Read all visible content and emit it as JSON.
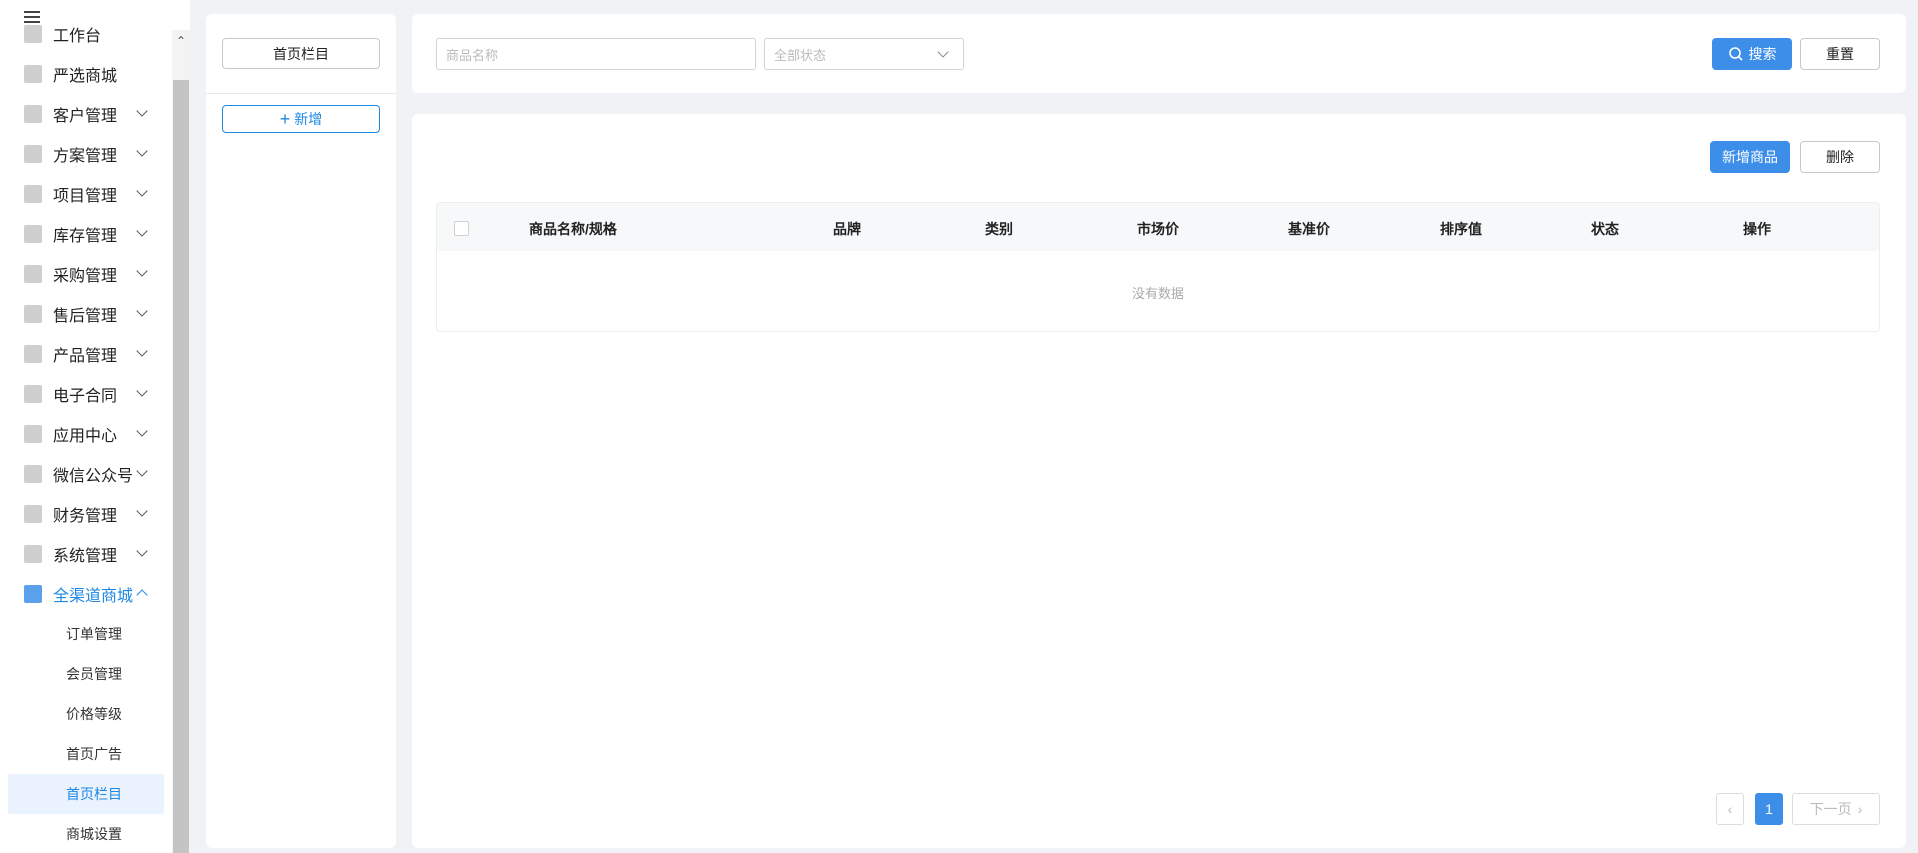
{
  "sidebar": {
    "items": [
      {
        "label": "工作台",
        "icon": "dashboard-icon"
      },
      {
        "label": "严选商城",
        "icon": "mall-icon"
      },
      {
        "label": "客户管理",
        "icon": "customer-icon"
      },
      {
        "label": "方案管理",
        "icon": "plan-icon"
      },
      {
        "label": "项目管理",
        "icon": "folder-icon"
      },
      {
        "label": "库存管理",
        "icon": "inventory-icon"
      },
      {
        "label": "采购管理",
        "icon": "cart-icon"
      },
      {
        "label": "售后管理",
        "icon": "headset-icon"
      },
      {
        "label": "产品管理",
        "icon": "box-icon"
      },
      {
        "label": "电子合同",
        "icon": "contract-icon"
      },
      {
        "label": "应用中心",
        "icon": "apps-icon"
      },
      {
        "label": "微信公众号",
        "icon": "wechat-icon"
      },
      {
        "label": "财务管理",
        "icon": "finance-icon"
      },
      {
        "label": "系统管理",
        "icon": "settings-icon"
      },
      {
        "label": "全渠道商城",
        "icon": "shop-icon"
      }
    ],
    "subitems": [
      "订单管理",
      "会员管理",
      "价格等级",
      "首页广告",
      "首页栏目",
      "商城设置"
    ],
    "selected_sub": "首页栏目",
    "accent": "#1e88e5"
  },
  "column_panel": {
    "column_button": "首页栏目",
    "add_button": "新增"
  },
  "search": {
    "name_placeholder": "商品名称",
    "status_placeholder": "全部状态",
    "search_button": "搜索",
    "reset_button": "重置"
  },
  "toolbar": {
    "add_product": "新增商品",
    "delete": "删除"
  },
  "table": {
    "columns": [
      "商品名称/规格",
      "品牌",
      "类别",
      "市场价",
      "基准价",
      "排序值",
      "状态",
      "操作"
    ],
    "rows": [],
    "empty_text": "没有数据"
  },
  "pagination": {
    "current_page": "1",
    "next_label": "下一页"
  }
}
